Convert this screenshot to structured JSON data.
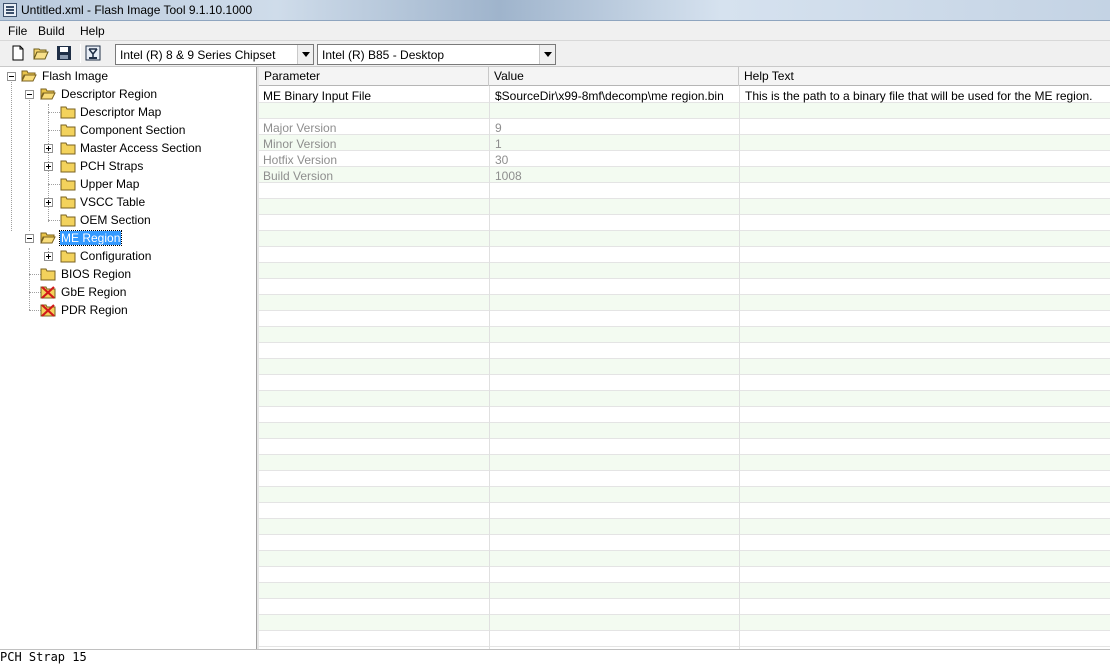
{
  "window": {
    "title": "Untitled.xml - Flash Image Tool 9.1.10.1000"
  },
  "menu": {
    "items": [
      "File",
      "Build",
      "Help"
    ]
  },
  "toolbar": {
    "icons": [
      "new-file-icon",
      "open-folder-icon",
      "save-icon",
      "build-image-icon"
    ],
    "chipset_combo": {
      "value": "Intel (R) 8 & 9 Series Chipset"
    },
    "platform_combo": {
      "value": "Intel (R) B85 - Desktop"
    }
  },
  "tree": {
    "root": "Flash Image",
    "descriptor_region": "Descriptor Region",
    "descriptor_children": [
      "Descriptor Map",
      "Component Section",
      "Master Access Section",
      "PCH Straps",
      "Upper Map",
      "VSCC Table",
      "OEM Section"
    ],
    "me_region": "ME Region",
    "me_children": [
      "Configuration"
    ],
    "bios_region": "BIOS Region",
    "gbe_region": "GbE Region",
    "pdr_region": "PDR Region"
  },
  "grid": {
    "columns": [
      "Parameter",
      "Value",
      "Help Text"
    ],
    "rows": [
      {
        "parameter": "ME Binary Input File",
        "value": "$SourceDir\\x99-8mf\\decomp\\me region.bin",
        "help": "This is the path to a binary file that will be used for the ME region.",
        "enabled": true
      },
      {
        "parameter": "",
        "value": "",
        "help": "",
        "enabled": true
      },
      {
        "parameter": "Major Version",
        "value": "9",
        "help": "",
        "enabled": false
      },
      {
        "parameter": "Minor Version",
        "value": "1",
        "help": "",
        "enabled": false
      },
      {
        "parameter": "Hotfix Version",
        "value": "30",
        "help": "",
        "enabled": false
      },
      {
        "parameter": "Build Version",
        "value": "1008",
        "help": "",
        "enabled": false
      }
    ]
  },
  "statusbar": {
    "text": "PCH Strap 15"
  },
  "colors": {
    "selection": "#3399ff",
    "alt_row": "#f3fbf1",
    "disabled_text": "#8e8e8e"
  }
}
